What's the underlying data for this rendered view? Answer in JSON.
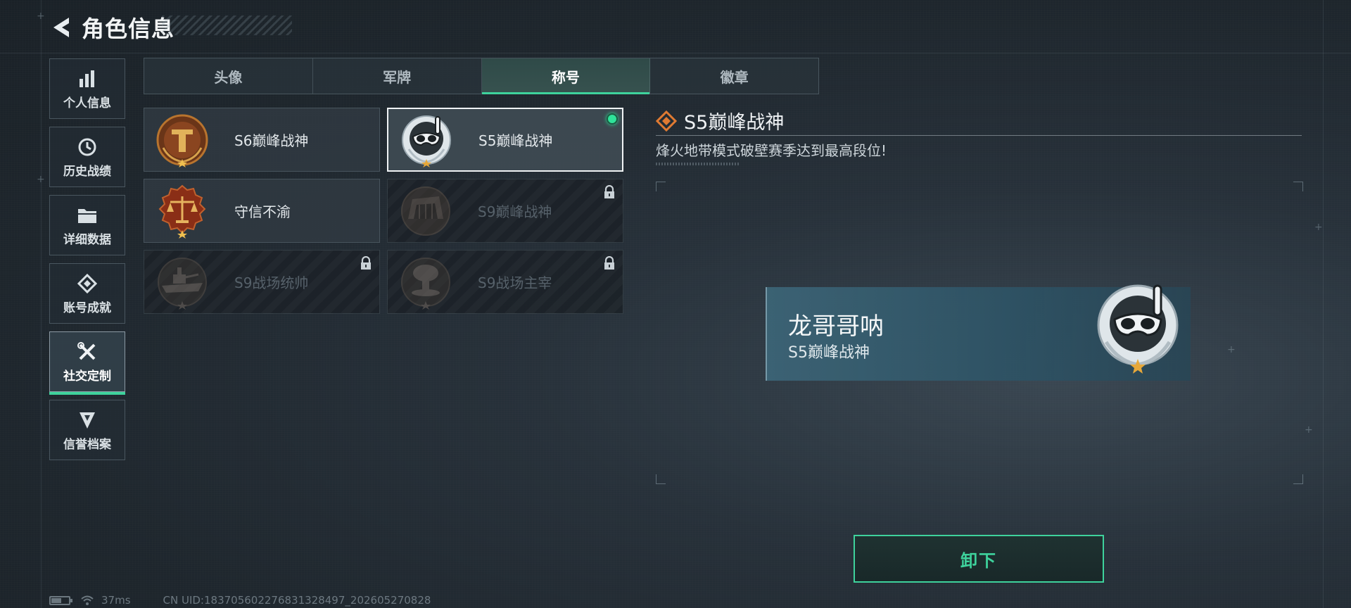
{
  "header": {
    "title": "角色信息"
  },
  "sidebar": {
    "items": [
      {
        "label": "个人信息",
        "icon": "bar-chart-icon"
      },
      {
        "label": "历史战绩",
        "icon": "history-icon"
      },
      {
        "label": "详细数据",
        "icon": "folder-icon"
      },
      {
        "label": "账号成就",
        "icon": "achievement-icon"
      },
      {
        "label": "社交定制",
        "icon": "tools-icon",
        "active": true
      },
      {
        "label": "信誉档案",
        "icon": "credibility-icon"
      }
    ]
  },
  "tabs": [
    {
      "label": "头像"
    },
    {
      "label": "军牌"
    },
    {
      "label": "称号",
      "active": true
    },
    {
      "label": "徽章"
    }
  ],
  "titles": [
    {
      "label": "S6巅峰战神",
      "locked": false
    },
    {
      "label": "S5巅峰战神",
      "locked": false,
      "selected": true,
      "equipped": true
    },
    {
      "label": "守信不渝",
      "locked": false
    },
    {
      "label": "S9巅峰战神",
      "locked": true
    },
    {
      "label": "S9战场统帅",
      "locked": true
    },
    {
      "label": "S9战场主宰",
      "locked": true
    }
  ],
  "detail": {
    "title": "S5巅峰战神",
    "description": "烽火地带模式破壁赛季达到最高段位!"
  },
  "nameplate": {
    "player_name": "龙哥哥呐",
    "title": "S5巅峰战神"
  },
  "action": {
    "label": "卸下"
  },
  "footer": {
    "ping": "37ms",
    "uid": "CN UID:18370560227683132849​7_202605270828"
  },
  "colors": {
    "accent": "#3ed29c",
    "equipped": "#2fe39a"
  }
}
